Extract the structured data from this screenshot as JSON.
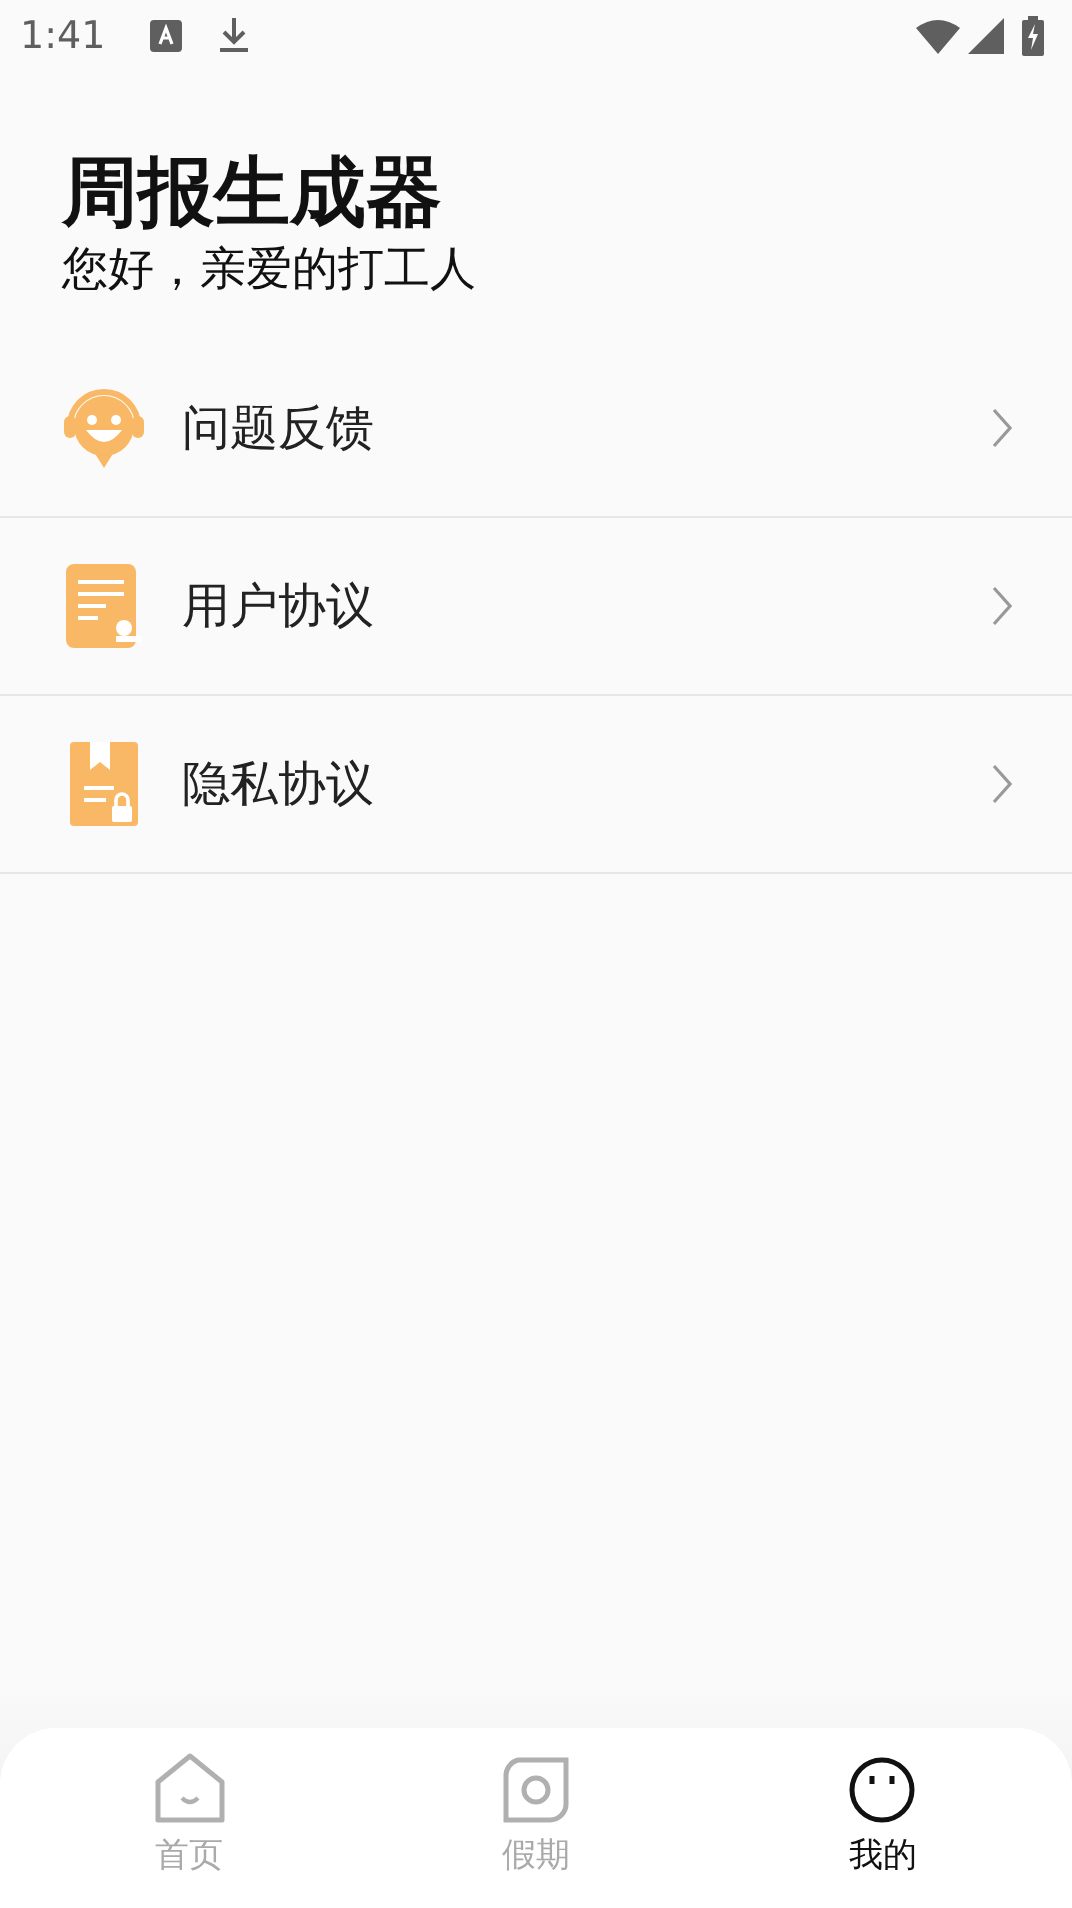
{
  "status_bar": {
    "time": "1:41"
  },
  "header": {
    "title": "周报生成器",
    "subtitle": "您好，亲爱的打工人"
  },
  "menu": [
    {
      "label": "问题反馈"
    },
    {
      "label": "用户协议"
    },
    {
      "label": "隐私协议"
    }
  ],
  "tabs": [
    {
      "label": "首页",
      "selected": false
    },
    {
      "label": "假期",
      "selected": false
    },
    {
      "label": "我的",
      "selected": true
    }
  ]
}
